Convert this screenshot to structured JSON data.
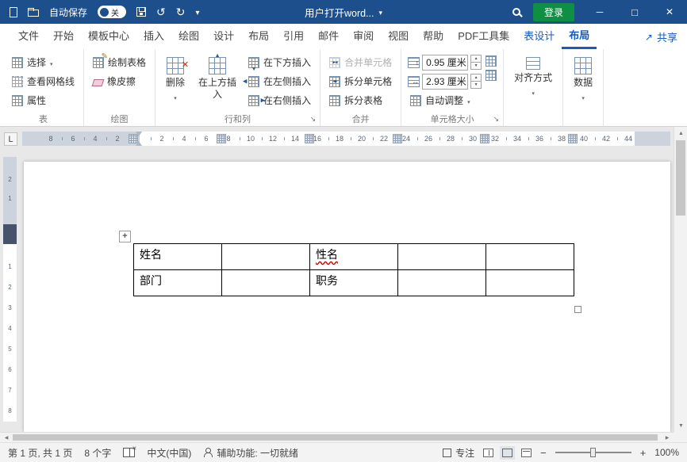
{
  "titlebar": {
    "autosave": "自动保存",
    "autosave_state": "关",
    "title": "用户打开word...",
    "login": "登录"
  },
  "tabs": {
    "items": [
      "文件",
      "开始",
      "模板中心",
      "插入",
      "绘图",
      "设计",
      "布局",
      "引用",
      "邮件",
      "审阅",
      "视图",
      "帮助",
      "PDF工具集",
      "表设计",
      "布局"
    ],
    "contextual_from": 13,
    "active_index": 14,
    "share_label": "共享"
  },
  "ribbon": {
    "table": {
      "label": "表",
      "select": "选择",
      "view_gridlines": "查看网格线",
      "properties": "属性"
    },
    "draw": {
      "label": "绘图",
      "draw_table": "绘制表格",
      "eraser": "橡皮擦"
    },
    "rows_cols": {
      "label": "行和列",
      "delete": "删除",
      "insert_above": "在上方插入",
      "insert_below": "在下方插入",
      "insert_left": "在左侧插入",
      "insert_right": "在右侧插入"
    },
    "merge": {
      "label": "合并",
      "merge_cells": "合并单元格",
      "split_cells": "拆分单元格",
      "split_table": "拆分表格"
    },
    "cell_size": {
      "label": "单元格大小",
      "height_value": "0.95 厘米",
      "width_value": "2.93 厘米",
      "autofit": "自动调整"
    },
    "alignment": {
      "label": "对齐方式"
    },
    "data": {
      "label": "数据"
    }
  },
  "ruler": {
    "h_margin": [
      8,
      6,
      4,
      2
    ],
    "h_main": [
      2,
      4,
      6,
      8,
      10,
      12,
      14,
      16,
      18,
      20,
      22,
      24,
      26,
      28,
      30,
      32,
      34,
      36,
      38,
      40,
      42,
      44
    ],
    "v_margin": [
      2,
      1
    ],
    "v_main": [
      1,
      2,
      3,
      4,
      5,
      6,
      7,
      8
    ]
  },
  "document": {
    "table": {
      "rows": [
        [
          {
            "text": "姓名"
          },
          {
            "text": ""
          },
          {
            "text": "性名",
            "misspelled": true
          },
          {
            "text": ""
          },
          {
            "text": ""
          }
        ],
        [
          {
            "text": "部门"
          },
          {
            "text": ""
          },
          {
            "text": "职务"
          },
          {
            "text": ""
          },
          {
            "text": ""
          }
        ]
      ]
    }
  },
  "statusbar": {
    "page_info": "第 1 页, 共 1 页",
    "word_count": "8 个字",
    "language": "中文(中国)",
    "accessibility_text": "辅助功能: 一切就绪",
    "focus": "专注",
    "zoom": "100%"
  },
  "colors": {
    "titlebar_bg": "#1d4f8c",
    "accent_blue": "#185abd",
    "login_green": "#0e8f43",
    "misspell_red": "#d40000"
  }
}
